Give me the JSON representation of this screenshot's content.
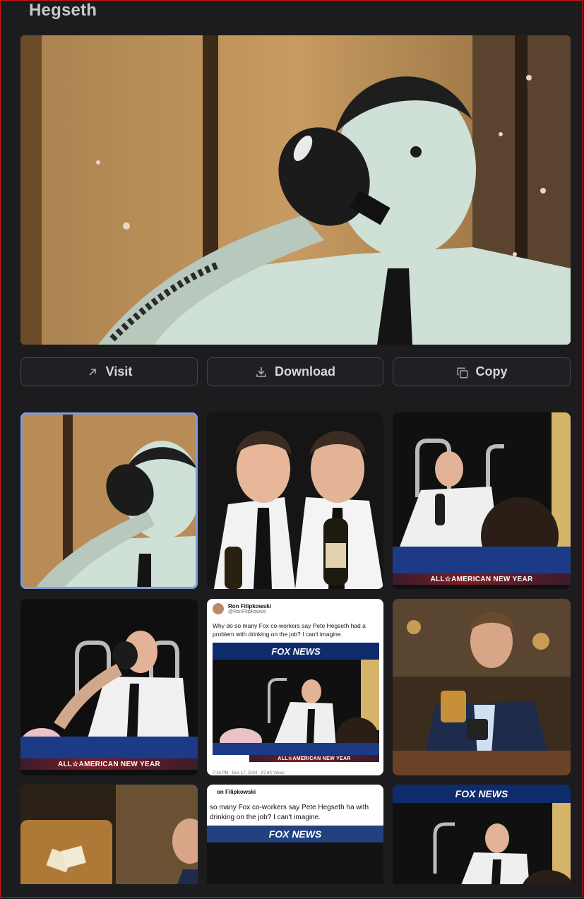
{
  "panel": {
    "title": "Hegseth"
  },
  "actions": {
    "visit": {
      "label": "Visit",
      "icon": "arrow-up-right-icon"
    },
    "download": {
      "label": "Download",
      "icon": "download-icon"
    },
    "copy": {
      "label": "Copy",
      "icon": "copy-icon"
    }
  },
  "thumbnails": [
    {
      "selected": true
    },
    {
      "selected": false
    },
    {
      "selected": false,
      "banner": "ALL☆AMERICAN NEW YEAR"
    },
    {
      "selected": false,
      "banner": "ALL☆AMERICAN NEW YEAR"
    },
    {
      "selected": false,
      "tweet": {
        "name": "Ron Filipkowski",
        "handle": "@RonFilipkowski",
        "text": "Why do so many Fox co-workers say Pete Hegseth had a problem with drinking on the job? I can't imagine.",
        "network": "FOX NEWS",
        "banner": "ALL☆AMERICAN NEW YEAR",
        "footer": "7:18 PM · Dec 17, 2024 · 87.6K Views"
      }
    },
    {
      "selected": false
    },
    {
      "selected": false
    },
    {
      "selected": false,
      "tweet": {
        "name": "on Filipkowski",
        "text": "so many Fox co-workers say Pete Hegseth ha with drinking on the job? I can't imagine.",
        "network": "FOX NEWS"
      }
    },
    {
      "selected": false,
      "network": "FOX NEWS"
    }
  ],
  "colors": {
    "accent": "#7f9bd8",
    "background": "#1c1c1e",
    "border": "#d0121b"
  }
}
